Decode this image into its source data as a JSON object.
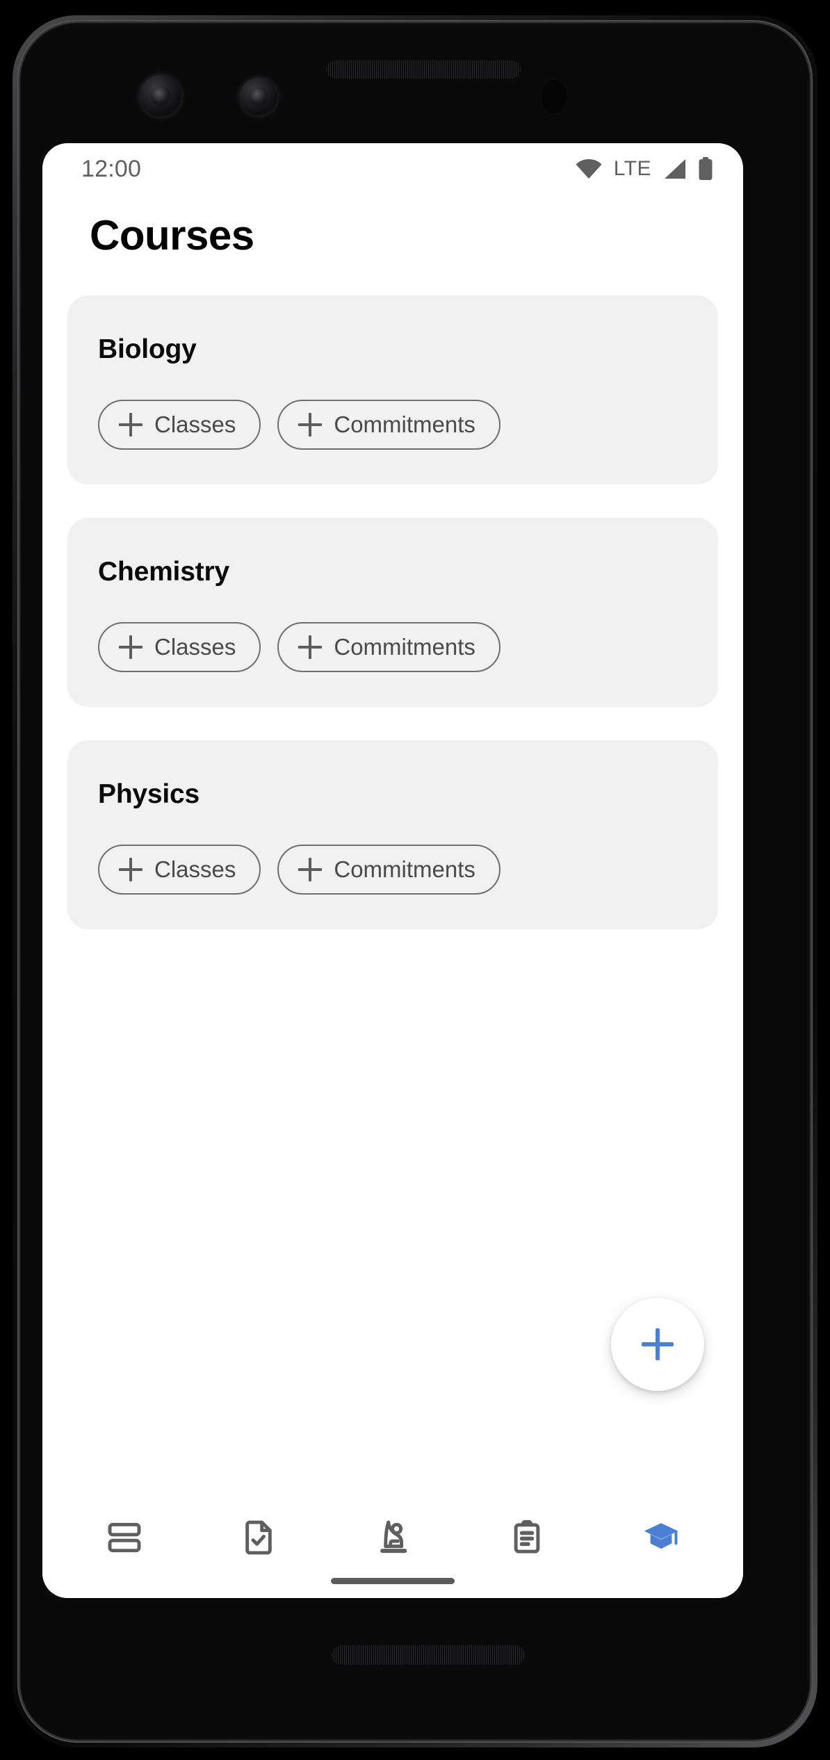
{
  "status_bar": {
    "time": "12:00",
    "network_label": "LTE",
    "icons": [
      "wifi-icon",
      "signal-icon",
      "battery-icon"
    ]
  },
  "header": {
    "title": "Courses"
  },
  "colors": {
    "accent": "#4a7fd4",
    "card_background": "#f1f1f1",
    "chip_border": "#6f6f6f",
    "chip_text": "#4a4a4a",
    "title_text": "#000000",
    "status_text": "#5f5f5f",
    "nav_inactive": "#5f5f5f",
    "nav_active": "#4a7fd4",
    "screen_background": "#ffffff"
  },
  "courses": [
    {
      "name": "Biology",
      "chips": [
        {
          "label": "Classes",
          "icon": "plus-icon"
        },
        {
          "label": "Commitments",
          "icon": "plus-icon"
        }
      ]
    },
    {
      "name": "Chemistry",
      "chips": [
        {
          "label": "Classes",
          "icon": "plus-icon"
        },
        {
          "label": "Commitments",
          "icon": "plus-icon"
        }
      ]
    },
    {
      "name": "Physics",
      "chips": [
        {
          "label": "Classes",
          "icon": "plus-icon"
        },
        {
          "label": "Commitments",
          "icon": "plus-icon"
        }
      ]
    }
  ],
  "fab": {
    "icon": "plus-icon",
    "label": "Add course"
  },
  "bottom_nav": {
    "active_index": 4,
    "items": [
      {
        "icon": "dashboard-icon",
        "label": "Dashboard",
        "active": false
      },
      {
        "icon": "document-check-icon",
        "label": "Assignments",
        "active": false
      },
      {
        "icon": "student-desk-icon",
        "label": "Classes",
        "active": false
      },
      {
        "icon": "clipboard-list-icon",
        "label": "Tasks",
        "active": false
      },
      {
        "icon": "graduation-cap-icon",
        "label": "Courses",
        "active": true
      }
    ]
  }
}
